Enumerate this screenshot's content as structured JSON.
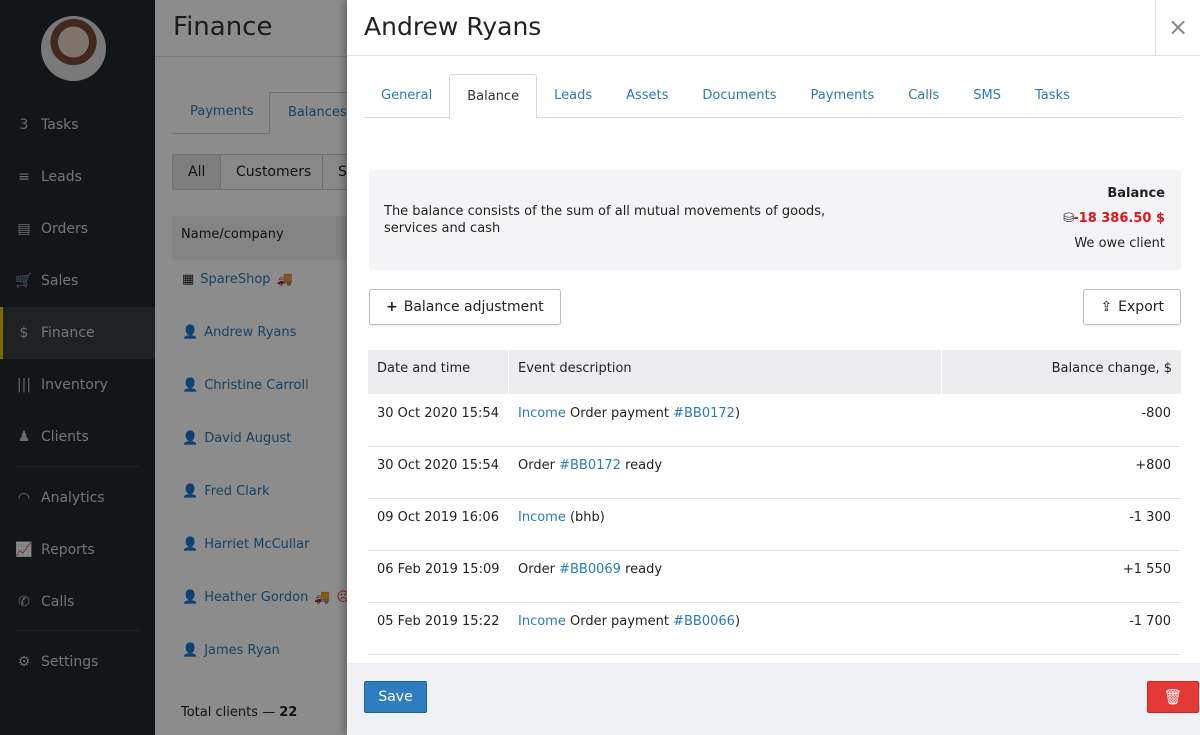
{
  "sidebar": {
    "items": [
      {
        "label": "Tasks",
        "icon": "tasks-icon",
        "badge": "3"
      },
      {
        "label": "Leads",
        "icon": "funnel-icon"
      },
      {
        "label": "Orders",
        "icon": "orders-icon"
      },
      {
        "label": "Sales",
        "icon": "cart-icon"
      },
      {
        "label": "Finance",
        "icon": "dollar-icon",
        "active": true
      },
      {
        "label": "Inventory",
        "icon": "barcode-icon"
      },
      {
        "label": "Clients",
        "icon": "clients-icon"
      },
      {
        "label": "Analytics",
        "icon": "gauge-icon"
      },
      {
        "label": "Reports",
        "icon": "chart-icon"
      },
      {
        "label": "Calls",
        "icon": "phone-icon"
      },
      {
        "label": "Settings",
        "icon": "gear-icon"
      }
    ]
  },
  "page": {
    "title": "Finance",
    "tabs": [
      "Payments",
      "Balances"
    ],
    "filters": [
      "All",
      "Customers",
      "S"
    ],
    "column": "Name/company",
    "clients": [
      "SpareShop",
      "Andrew Ryans",
      "Christine Carroll",
      "David August",
      "Fred Clark",
      "Harriet McCullar",
      "Heather Gordon",
      "James Ryan"
    ],
    "total_label": "Total clients — ",
    "total": "22"
  },
  "modal": {
    "title": "Andrew Ryans",
    "close": "×",
    "tabs": [
      "General",
      "Balance",
      "Leads",
      "Assets",
      "Documents",
      "Payments",
      "Calls",
      "SMS",
      "Tasks"
    ],
    "active_tab": "Balance",
    "info": {
      "description": "The balance consists of the sum of all mutual movements of goods, services and cash",
      "balance_label": "Balance",
      "balance": "-18 386.50 $",
      "status": "We owe client"
    },
    "adjust_button": "Balance adjustment",
    "export_button": "Export",
    "columns": [
      "Date and time",
      "Event description",
      "Balance change, $"
    ],
    "rows": [
      {
        "date": "30 Oct 2020 15:54",
        "link": "Income",
        "text": "Order payment",
        "ref": "#BB0172",
        "tail": ")",
        "change": "-800"
      },
      {
        "date": "30 Oct 2020 15:54",
        "pre": "Order",
        "ref": "#BB0172",
        "text2": "ready",
        "change": "+800"
      },
      {
        "date": "09 Oct 2019 16:06",
        "link": "Income",
        "text": "(bhb)",
        "change": "-1 300"
      },
      {
        "date": "06 Feb 2019 15:09",
        "pre": "Order",
        "ref": "#BB0069",
        "text2": "ready",
        "change": "+1 550"
      },
      {
        "date": "05 Feb 2019 15:22",
        "link": "Income",
        "text": "Order payment",
        "ref": "#BB0066",
        "tail": ")",
        "change": "-1 700"
      }
    ],
    "save": "Save"
  },
  "colors": {
    "link": "#2a7ab8",
    "negative": "#e0151b",
    "save": "#2f7dc1",
    "delete": "#e53935",
    "active_marker": "#e8c200"
  }
}
